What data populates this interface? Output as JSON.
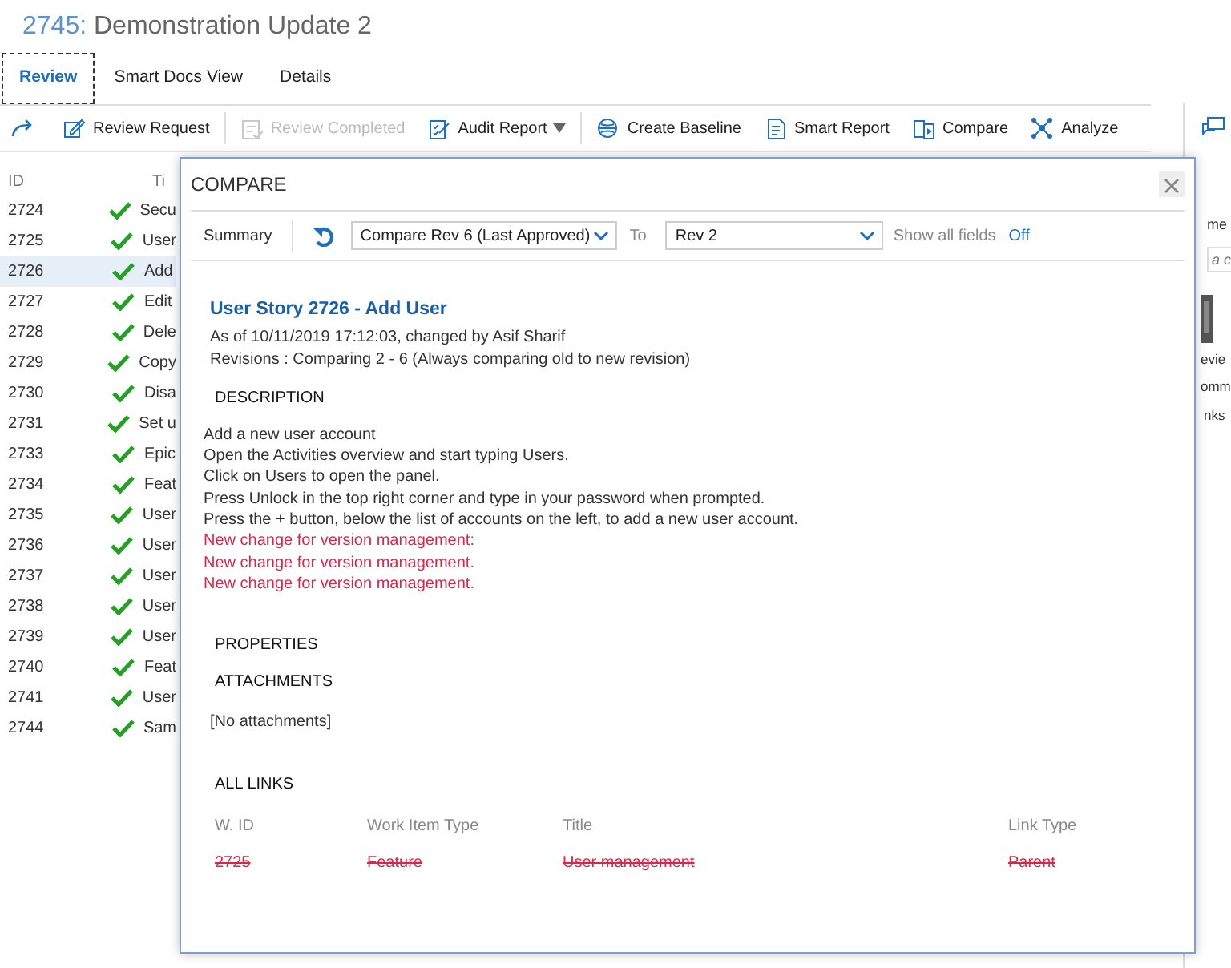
{
  "page_title": {
    "id": "2745:",
    "name": "Demonstration Update 2"
  },
  "tabs": [
    {
      "label": "Review",
      "selected": true
    },
    {
      "label": "Smart Docs View",
      "selected": false
    },
    {
      "label": "Details",
      "selected": false
    }
  ],
  "toolbar": [
    {
      "buttons": [
        {
          "label": "Review Request",
          "disabled": false,
          "dropdown": false
        }
      ]
    },
    {
      "buttons": [
        {
          "label": "Review Completed",
          "disabled": true,
          "dropdown": false
        },
        {
          "label": "Audit Report",
          "disabled": false,
          "dropdown": true
        }
      ]
    },
    {
      "buttons": [
        {
          "label": "Create Baseline",
          "disabled": false,
          "dropdown": false
        },
        {
          "label": "Smart Report",
          "disabled": false,
          "dropdown": false
        },
        {
          "label": "Compare",
          "disabled": false,
          "dropdown": false
        },
        {
          "label": "Analyze",
          "disabled": false,
          "dropdown": false
        }
      ]
    }
  ],
  "work_items": {
    "columns": [
      "ID",
      "Ti"
    ],
    "rows": [
      {
        "id": "2724",
        "title": "Secu",
        "selected": false
      },
      {
        "id": "2725",
        "title": "User",
        "selected": false
      },
      {
        "id": "2726",
        "title": "Add",
        "selected": true
      },
      {
        "id": "2727",
        "title": "Edit",
        "selected": false
      },
      {
        "id": "2728",
        "title": "Dele",
        "selected": false
      },
      {
        "id": "2729",
        "title": "Copy",
        "selected": false
      },
      {
        "id": "2730",
        "title": "Disa",
        "selected": false
      },
      {
        "id": "2731",
        "title": "Set u",
        "selected": false
      },
      {
        "id": "2733",
        "title": "Epic",
        "selected": false
      },
      {
        "id": "2734",
        "title": "Feat",
        "selected": false
      },
      {
        "id": "2735",
        "title": "User",
        "selected": false
      },
      {
        "id": "2736",
        "title": "User",
        "selected": false
      },
      {
        "id": "2737",
        "title": "User",
        "selected": false
      },
      {
        "id": "2738",
        "title": "User",
        "selected": false
      },
      {
        "id": "2739",
        "title": "User",
        "selected": false
      },
      {
        "id": "2740",
        "title": "Feat",
        "selected": false
      },
      {
        "id": "2741",
        "title": "User",
        "selected": false
      },
      {
        "id": "2744",
        "title": "Sam",
        "selected": false
      }
    ]
  },
  "right_panel": {
    "heading": "me",
    "search_placeholder": "a c",
    "items": [
      "evie",
      "omm",
      "nks"
    ]
  },
  "dialog": {
    "title": "COMPARE",
    "summary_label": "Summary",
    "from_revision": "Compare Rev 6 (Last Approved)",
    "to_label": "To",
    "to_revision": "Rev 2",
    "show_all_label": "Show all fields",
    "show_all_value": "Off",
    "heading": "User Story 2726 - Add User",
    "meta": [
      "As of 10/11/2019 17:12:03, changed by Asif Sharif",
      "Revisions : Comparing 2 - 6 (Always comparing old to new revision)"
    ],
    "description_title": "DESCRIPTION",
    "description": [
      {
        "text": "Add a new user account",
        "changed": false
      },
      {
        "text": "Open the Activities overview and start typing Users.",
        "changed": false
      },
      {
        "text": "Click on Users to open the panel.",
        "changed": false
      },
      {
        "text": "Press Unlock in the top right corner and type in your password when prompted.",
        "changed": false
      },
      {
        "text": "Press the + button, below the list of accounts on the left, to add a new user account.",
        "changed": false
      },
      {
        "text": "New change for version management:",
        "changed": true
      },
      {
        "text": "New change for version management.",
        "changed": true
      },
      {
        "text": "New change for version management.",
        "changed": true
      }
    ],
    "properties_title": "PROPERTIES",
    "attachments_title": "ATTACHMENTS",
    "attachments_empty": "[No attachments]",
    "links_title": "ALL LINKS",
    "links_columns": [
      "W. ID",
      "Work Item Type",
      "Title",
      "Link Type"
    ],
    "links_rows": [
      {
        "cells": [
          "2725",
          "Feature",
          "User management",
          "Parent"
        ],
        "removed": true
      }
    ]
  }
}
